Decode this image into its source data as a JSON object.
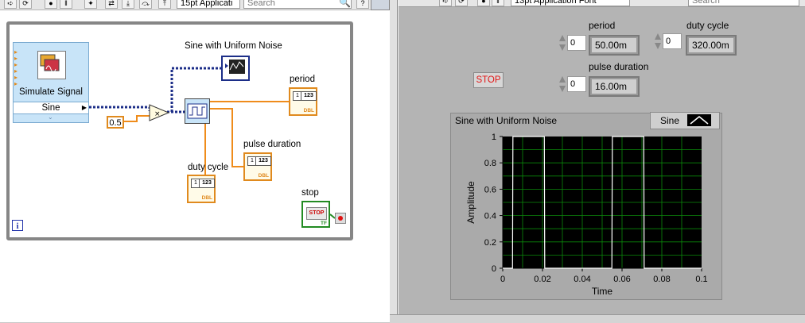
{
  "block_diagram": {
    "toolbar": {
      "font_ring": "15pt Applicati",
      "search_placeholder": "Search"
    },
    "simulate_signal": {
      "title": "Simulate Signal",
      "output": "Sine"
    },
    "constant_value": "0.5",
    "graph_label": "Sine with Uniform Noise",
    "period_label": "period",
    "pulse_duration_label": "pulse duration",
    "duty_cycle_label": "duty cycle",
    "stop_label": "stop",
    "indicator_display": "123",
    "indicator_type": "DBL",
    "stop_term_text": "STOP",
    "stop_term_type": "TF",
    "loop_iteration": "i"
  },
  "front_panel": {
    "toolbar": {
      "font_ring": "13pt Application Font",
      "search_placeholder": "Search"
    },
    "period": {
      "label": "period",
      "index": "0",
      "value": "50.00m"
    },
    "duty_cycle": {
      "label": "duty cycle",
      "index": "0",
      "value": "320.00m"
    },
    "pulse_duration": {
      "label": "pulse duration",
      "index": "0",
      "value": "16.00m"
    },
    "stop_button": "STOP"
  },
  "chart_data": {
    "type": "line",
    "title": "Sine with Uniform Noise",
    "xlabel": "Time",
    "ylabel": "Amplitude",
    "xlim": [
      0,
      0.1
    ],
    "ylim": [
      0,
      1
    ],
    "x_ticks": [
      "0",
      "0.02",
      "0.04",
      "0.06",
      "0.08",
      "0.1"
    ],
    "y_ticks": [
      "0",
      "0.2",
      "0.4",
      "0.6",
      "0.8",
      "1"
    ],
    "grid": true,
    "legend": "top-right",
    "series": [
      {
        "name": "Sine",
        "color": "#ffffff",
        "x": [
          0,
          0.0049,
          0.0051,
          0.0209,
          0.0211,
          0.0549,
          0.0551,
          0.0709,
          0.0711,
          0.1
        ],
        "values": [
          0,
          0,
          1,
          1,
          0,
          0,
          1,
          1,
          0,
          0
        ]
      }
    ],
    "colors": {
      "plot_bg": "#000000",
      "grid": "#0b8a0b",
      "trace": "#ffffff"
    }
  }
}
